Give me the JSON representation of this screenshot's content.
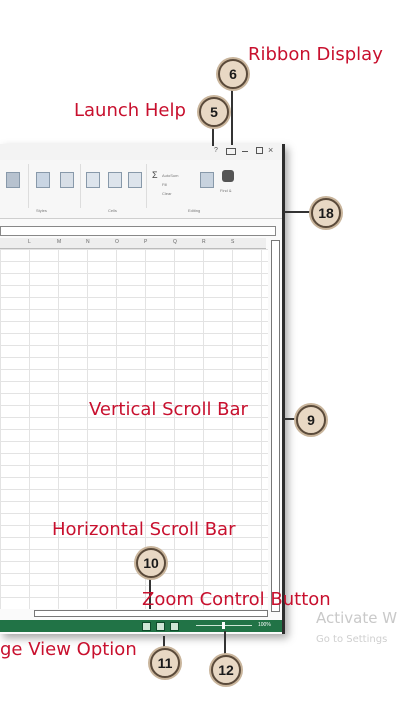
{
  "callouts": [
    {
      "number": "6",
      "label": "Ribbon Display"
    },
    {
      "number": "5",
      "label": "Launch Help"
    },
    {
      "number": "18",
      "label": ""
    },
    {
      "number": "9",
      "label": "Vertical Scroll Bar"
    },
    {
      "number": "10",
      "label": "Horizontal Scroll Bar"
    },
    {
      "number": "11",
      "label": "ge View Option"
    },
    {
      "number": "12",
      "label": "Zoom Control Button"
    }
  ],
  "columns": [
    "L",
    "M",
    "N",
    "O",
    "P",
    "Q",
    "R",
    "S"
  ],
  "ribbon": {
    "find_label": "Find &",
    "select_label": "Select",
    "autosum_label": "AutoSum",
    "fill_label": "Fill",
    "clear_label": "Clear",
    "editing_group": "Editing",
    "cells_group": "Cells",
    "styles_group": "Styles"
  },
  "status": {
    "zoom": "100%"
  },
  "watermark": {
    "line1": "Activate W",
    "line2": "Go to Settings"
  },
  "colors": {
    "label_red": "#c8102e",
    "status_green": "#217346",
    "badge_fill": "#e8d8c4"
  },
  "icons": [
    "help-question-icon",
    "ribbon-display-icon",
    "minimize-icon",
    "maximize-icon",
    "close-icon",
    "sum-icon",
    "sort-filter-icon",
    "find-binoculars-icon"
  ]
}
